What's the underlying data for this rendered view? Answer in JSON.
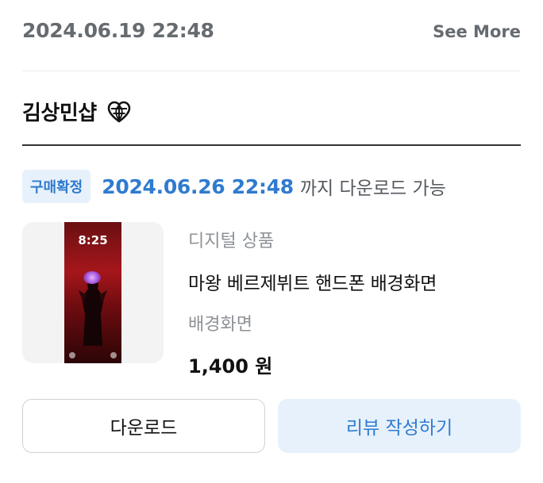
{
  "header": {
    "order_date": "2024.06.19 22:48",
    "see_more": "See More"
  },
  "seller": {
    "name": "김상민샵",
    "icon": "heart-globe-icon"
  },
  "status": {
    "badge": "구매확정",
    "deadline": "2024.06.26 22:48",
    "deadline_suffix": "까지 다운로드 가능",
    "accent_color": "#2f7bd0"
  },
  "product": {
    "thumbnail_time": "8:25",
    "category": "디지털 상품",
    "title": "마왕 베르제뷔트 핸드폰 배경화면",
    "option": "배경화면",
    "price": "1,400 원"
  },
  "actions": {
    "download_label": "다운로드",
    "review_label": "리뷰 작성하기"
  }
}
